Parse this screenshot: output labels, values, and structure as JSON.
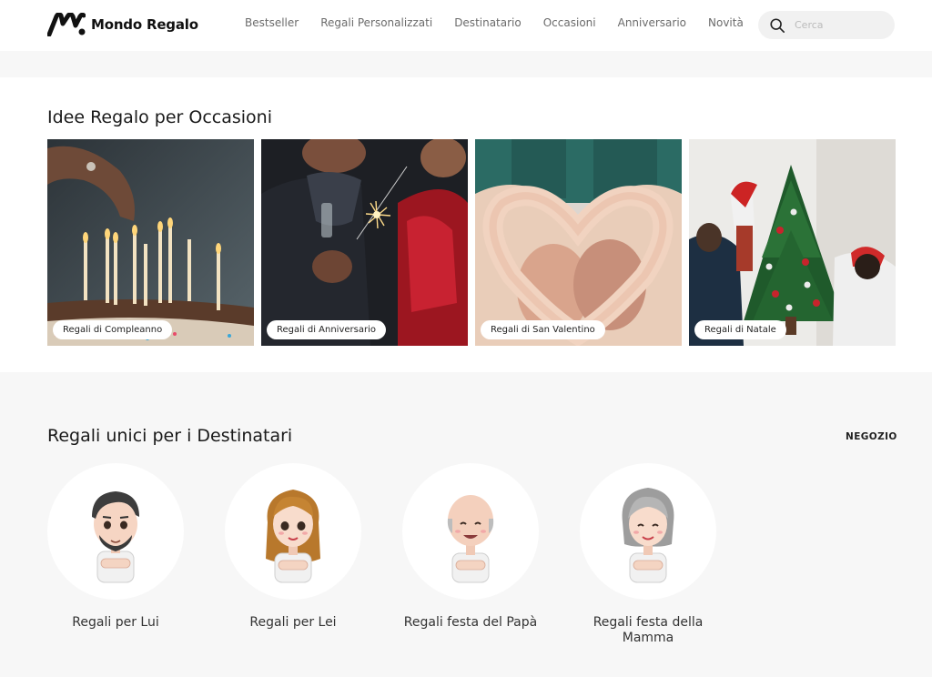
{
  "brand": {
    "name": "Mondo Regalo"
  },
  "nav": {
    "items": [
      {
        "label": "Bestseller"
      },
      {
        "label": "Regali Personalizzati"
      },
      {
        "label": "Destinatario"
      },
      {
        "label": "Occasioni"
      },
      {
        "label": "Anniversario"
      },
      {
        "label": "Novità"
      }
    ]
  },
  "search": {
    "placeholder": "Cerca",
    "icon": "search-icon"
  },
  "occasions": {
    "title": "Idee Regalo per Occasioni",
    "cards": [
      {
        "label": "Regali di Compleanno",
        "image": "birthday-candles-photo"
      },
      {
        "label": "Regali di Anniversario",
        "image": "couple-sparkler-photo"
      },
      {
        "label": "Regali di San Valentino",
        "image": "heart-hands-kiss-photo"
      },
      {
        "label": "Regali di Natale",
        "image": "christmas-tree-family-photo"
      }
    ]
  },
  "recipients": {
    "title": "Regali unici per i Destinatari",
    "shop_link": "NEGOZIO",
    "items": [
      {
        "label": "Regali per Lui",
        "avatar": "man-avatar"
      },
      {
        "label": "Regali per Lei",
        "avatar": "woman-avatar"
      },
      {
        "label": "Regali festa del Papà",
        "avatar": "dad-avatar"
      },
      {
        "label": "Regali festa della Mamma",
        "avatar": "mom-avatar"
      }
    ]
  }
}
